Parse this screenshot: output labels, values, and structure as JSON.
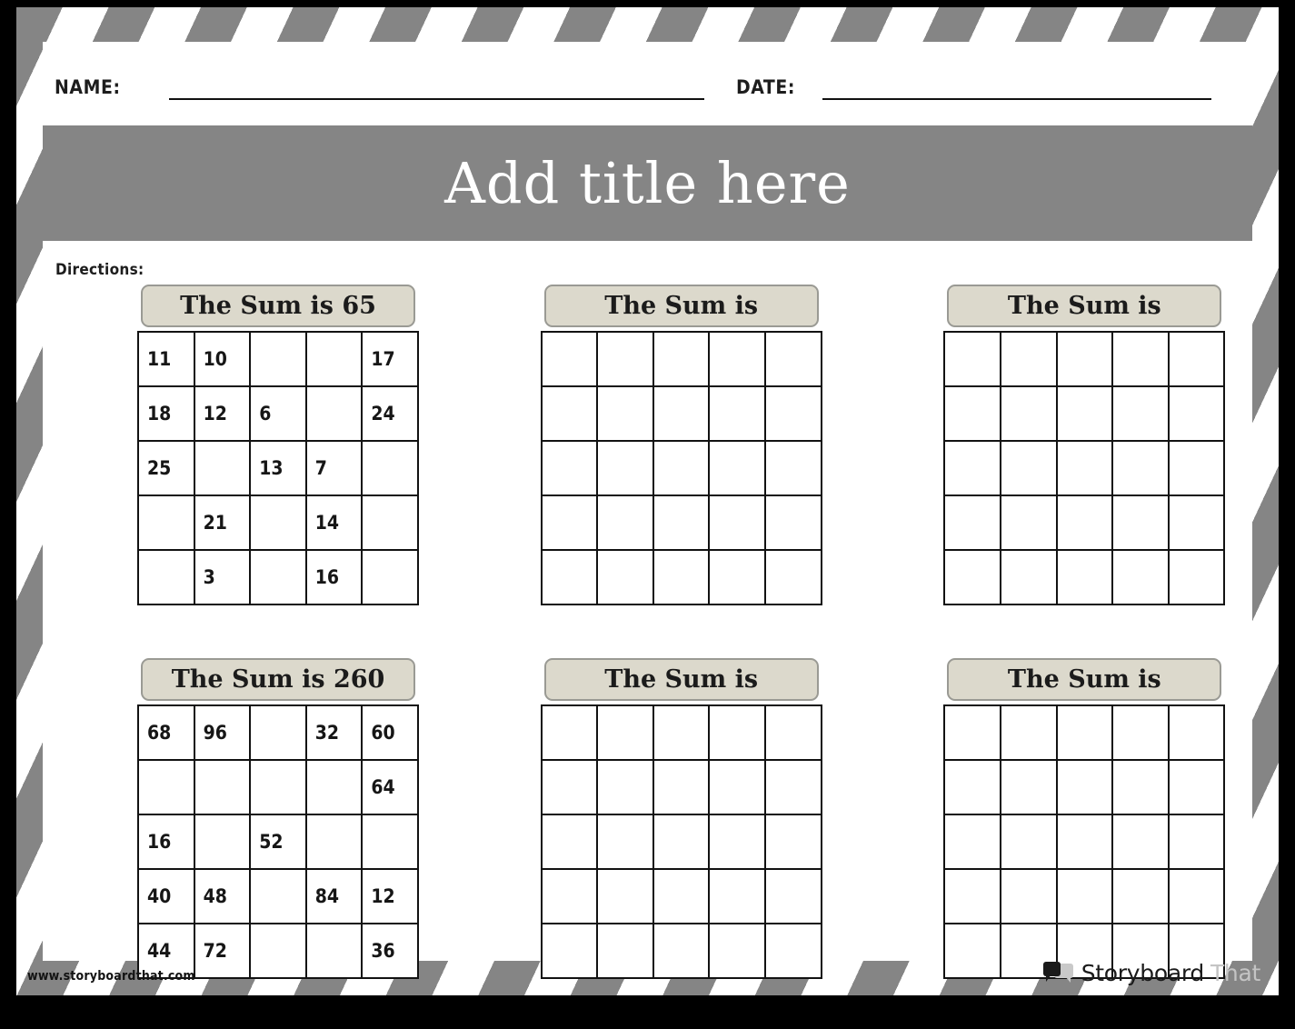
{
  "header": {
    "name_label": "NAME:",
    "date_label": "DATE:",
    "name_value": "",
    "date_value": ""
  },
  "title": "Add title here",
  "directions_label": "Directions:",
  "colors": {
    "frame_gray": "#858585",
    "pill_fill": "#dcd9cc",
    "pill_border": "#9a9a94",
    "grid_line": "#121212",
    "title_text": "#ffffff",
    "brand_dark": "#1a1a1a",
    "brand_light": "#c4c4c4"
  },
  "puzzles": [
    {
      "label": "The Sum is 65",
      "sum": 65,
      "rows": 5,
      "cols": 5,
      "cells": [
        [
          "11",
          "10",
          "",
          "",
          "17"
        ],
        [
          "18",
          "12",
          "6",
          "",
          "24"
        ],
        [
          "25",
          "",
          "13",
          "7",
          ""
        ],
        [
          "",
          "21",
          "",
          "14",
          ""
        ],
        [
          "",
          "3",
          "",
          "16",
          ""
        ]
      ]
    },
    {
      "label": "The Sum is",
      "sum": null,
      "rows": 5,
      "cols": 5,
      "cells": [
        [
          "",
          "",
          "",
          "",
          ""
        ],
        [
          "",
          "",
          "",
          "",
          ""
        ],
        [
          "",
          "",
          "",
          "",
          ""
        ],
        [
          "",
          "",
          "",
          "",
          ""
        ],
        [
          "",
          "",
          "",
          "",
          ""
        ]
      ]
    },
    {
      "label": "The Sum is",
      "sum": null,
      "rows": 5,
      "cols": 5,
      "cells": [
        [
          "",
          "",
          "",
          "",
          ""
        ],
        [
          "",
          "",
          "",
          "",
          ""
        ],
        [
          "",
          "",
          "",
          "",
          ""
        ],
        [
          "",
          "",
          "",
          "",
          ""
        ],
        [
          "",
          "",
          "",
          "",
          ""
        ]
      ]
    },
    {
      "label": "The Sum is 260",
      "sum": 260,
      "rows": 5,
      "cols": 5,
      "cells": [
        [
          "68",
          "96",
          "",
          "32",
          "60"
        ],
        [
          "",
          "",
          "",
          "",
          "64"
        ],
        [
          "16",
          "",
          "52",
          "",
          ""
        ],
        [
          "40",
          "48",
          "",
          "84",
          "12"
        ],
        [
          "44",
          "72",
          "",
          "",
          "36"
        ]
      ]
    },
    {
      "label": "The Sum is",
      "sum": null,
      "rows": 5,
      "cols": 5,
      "cells": [
        [
          "",
          "",
          "",
          "",
          ""
        ],
        [
          "",
          "",
          "",
          "",
          ""
        ],
        [
          "",
          "",
          "",
          "",
          ""
        ],
        [
          "",
          "",
          "",
          "",
          ""
        ],
        [
          "",
          "",
          "",
          "",
          ""
        ]
      ]
    },
    {
      "label": "The Sum is",
      "sum": null,
      "rows": 5,
      "cols": 5,
      "cells": [
        [
          "",
          "",
          "",
          "",
          ""
        ],
        [
          "",
          "",
          "",
          "",
          ""
        ],
        [
          "",
          "",
          "",
          "",
          ""
        ],
        [
          "",
          "",
          "",
          "",
          ""
        ],
        [
          "",
          "",
          "",
          "",
          ""
        ]
      ]
    }
  ],
  "footer": {
    "url": "www.storyboardthat.com",
    "brand_primary": "Storyboard",
    "brand_secondary": "That"
  }
}
